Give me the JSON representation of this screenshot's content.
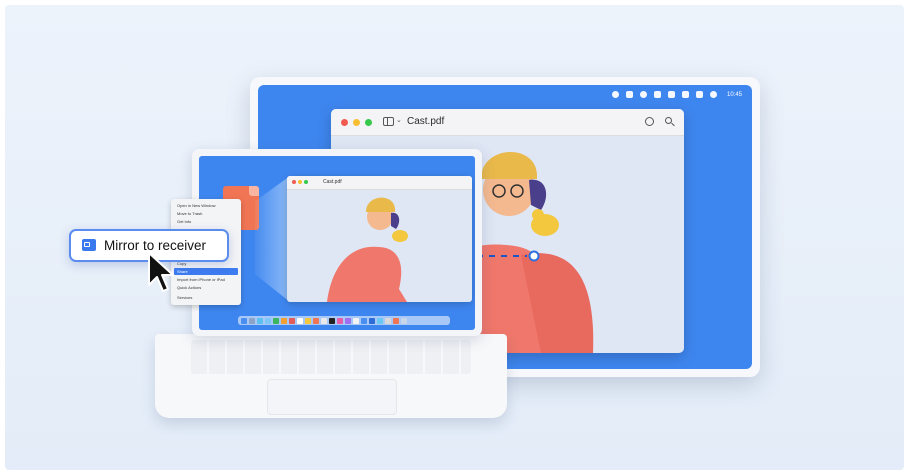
{
  "monitor": {
    "clock": "10:45",
    "window": {
      "title": "Cast.pdf"
    }
  },
  "laptop": {
    "window": {
      "title": "Cast.pdf"
    },
    "context_menu": {
      "items": [
        "Open in New Window",
        "Move to Trash",
        "Get Info",
        "Copy",
        "Share",
        "Import from iPhone or iPad",
        "Quick Actions",
        "Services"
      ],
      "selected": "Share"
    }
  },
  "mirror_action": {
    "label": "Mirror to receiver"
  },
  "colors": {
    "accent": "#3a78ee",
    "screen": "#3e86ef",
    "figure": "#f0776b"
  },
  "icons": [
    "search-icon",
    "person-circle-icon",
    "sidebar-toggle-icon",
    "chevron-down-icon",
    "cast-icon",
    "cursor-arrow-icon",
    "pdf-file-icon"
  ]
}
